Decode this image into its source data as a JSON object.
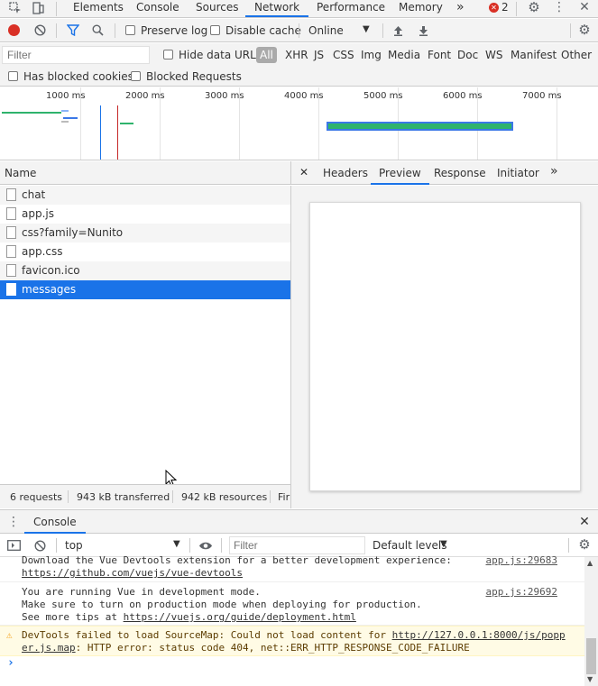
{
  "devtools": {
    "tabs": [
      "Elements",
      "Console",
      "Sources",
      "Network",
      "Performance",
      "Memory"
    ],
    "more_tabs": "»",
    "error_count": "2",
    "active_tab": "Network"
  },
  "network_toolbar": {
    "preserve_log": "Preserve log",
    "disable_cache": "Disable cache",
    "throttle": "Online",
    "filter_placeholder": "Filter",
    "hide_data_urls": "Hide data URLs",
    "types": [
      "All",
      "XHR",
      "JS",
      "CSS",
      "Img",
      "Media",
      "Font",
      "Doc",
      "WS",
      "Manifest",
      "Other"
    ],
    "has_blocked_cookies": "Has blocked cookies",
    "blocked_requests": "Blocked Requests"
  },
  "timeline": {
    "ticks": [
      "1000 ms",
      "2000 ms",
      "3000 ms",
      "4000 ms",
      "5000 ms",
      "6000 ms",
      "7000 ms"
    ]
  },
  "requests": {
    "header_name": "Name",
    "items": [
      "chat",
      "app.js",
      "css?family=Nunito",
      "app.css",
      "favicon.ico",
      "messages"
    ],
    "selected": "messages"
  },
  "status": {
    "requests": "6 requests",
    "transferred": "943 kB transferred",
    "resources": "942 kB resources",
    "finish": "Fir"
  },
  "detail_tabs": [
    "Headers",
    "Preview",
    "Response",
    "Initiator"
  ],
  "detail_active": "Preview",
  "drawer": {
    "title": "Console",
    "context": "top",
    "filter_placeholder": "Filter",
    "levels": "Default levels"
  },
  "console": {
    "msg1_line1": "Download the Vue Devtools extension for a better development experience:",
    "msg1_link": "https://github.com/vuejs/vue-devtools",
    "msg1_src": "app.js:29683",
    "msg2_line1": "You are running Vue in development mode.",
    "msg2_line2": "Make sure to turn on production mode when deploying for production.",
    "msg2_line3_prefix": "See more tips at ",
    "msg2_link": "https://vuejs.org/guide/deployment.html",
    "msg2_src": "app.js:29692",
    "warn_prefix": "DevTools failed to load SourceMap: Could not load content for ",
    "warn_link1": "http://127.0.0.1:8000/js/popp",
    "warn_link2": "er.js.map",
    "warn_suffix": ": HTTP error: status code 404, net::ERR_HTTP_RESPONSE_CODE_FAILURE",
    "prompt": "›"
  },
  "colors": {
    "accent": "#1a73e8",
    "record": "#d93025",
    "bar_green": "#2fb36c",
    "bar_blue": "#3b78e7"
  }
}
